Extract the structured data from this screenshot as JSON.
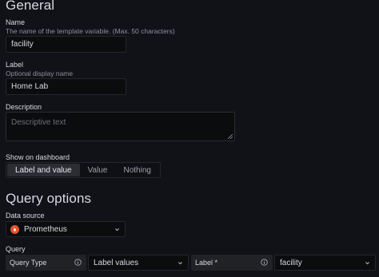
{
  "general": {
    "heading": "General",
    "name": {
      "label": "Name",
      "description": "The name of the template variable. (Max. 50 characters)",
      "value": "facility"
    },
    "label": {
      "label": "Label",
      "description": "Optional display name",
      "value": "Home Lab"
    },
    "description": {
      "label": "Description",
      "placeholder": "Descriptive text"
    },
    "show_on_dashboard": {
      "label": "Show on dashboard",
      "options": [
        "Label and value",
        "Value",
        "Nothing"
      ],
      "selected": "Label and value"
    }
  },
  "query_options": {
    "heading": "Query options",
    "data_source": {
      "label": "Data source",
      "value": "Prometheus",
      "icon": "prometheus-logo",
      "brand_color": "#e6522c"
    },
    "query": {
      "label": "Query",
      "query_type_label": "Query Type",
      "query_type_value": "Label values",
      "label_label": "Label *",
      "label_value": "facility"
    }
  },
  "colors": {
    "background": "#111217",
    "input_background": "#0b0c0e",
    "active_segment": "#2b2d33"
  }
}
